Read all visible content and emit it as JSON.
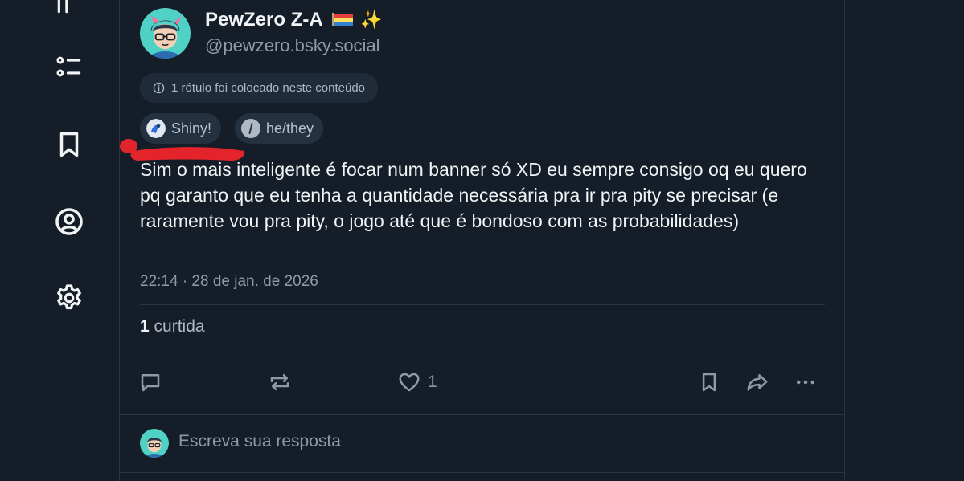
{
  "sidebar": {
    "icons": [
      "feeds-icon",
      "bookmarks-icon",
      "profile-icon",
      "settings-icon"
    ]
  },
  "post": {
    "author": {
      "display_name": "PewZero Z-A",
      "handle": "@pewzero.bsky.social",
      "name_emoji": [
        "flag-icon",
        "sparkles-icon"
      ]
    },
    "label_notice": "1 rótulo foi colocado neste conteúdo",
    "labels": [
      {
        "text": "Shiny!",
        "icon": "labeler-avatar-icon"
      },
      {
        "text": "he/they",
        "icon": "pronoun-label-icon"
      }
    ],
    "text": "Sim o mais inteligente é focar num banner só XD eu sempre consigo oq eu quero pq garanto que eu tenha a quantidade necessária pra ir pra pity se precisar (e raramente vou pra pity, o jogo até que é bondoso com as probabilidades)",
    "timestamp": "22:14 · 28 de jan. de 2026",
    "likes": {
      "count": "1",
      "label": "curtida"
    },
    "actions": {
      "reply_icon": "reply-icon",
      "repost_icon": "repost-icon",
      "like_icon": "heart-icon",
      "like_count": "1",
      "bookmark_icon": "bookmark-icon",
      "share_icon": "share-icon",
      "more_icon": "more-icon"
    }
  },
  "reply_box": {
    "placeholder": "Escreva sua resposta"
  },
  "colors": {
    "background": "#151e28",
    "text_primary": "#f1f3f5",
    "text_secondary": "#8d9aa8",
    "chip_bg": "#243140",
    "annotation_red": "#e3252b"
  }
}
